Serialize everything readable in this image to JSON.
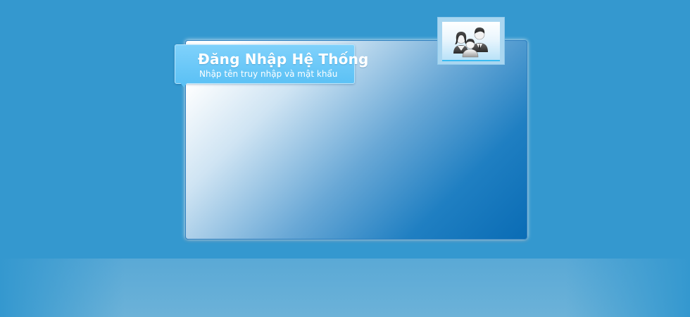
{
  "login": {
    "title": "Đăng Nhập Hệ Thống",
    "subtitle": "Nhập tên truy nhập và mật khẩu"
  },
  "icons": {
    "users": "users-icon"
  },
  "colors": {
    "background": "#3498cf",
    "title_tag": "#5cc1f5",
    "panel_dark": "#0a6cb5"
  }
}
